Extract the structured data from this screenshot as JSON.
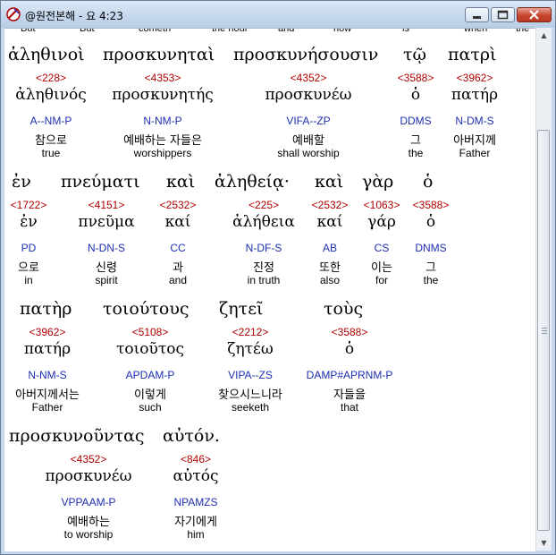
{
  "window": {
    "title": "@원전본해 - 요 4:23"
  },
  "top_strip": [
    "But",
    "But",
    "cometh",
    "the hour",
    "and",
    "now",
    "is",
    "when",
    "the"
  ],
  "rows": [
    [
      {
        "greek": "ἀληθινοὶ",
        "num": "<228>",
        "lex": "ἀληθινός",
        "morph": "A--NM-P",
        "kor": "참으로",
        "eng": "true"
      },
      {
        "greek": "προσκυνηταὶ",
        "num": "<4353>",
        "lex": "προσκυνητής",
        "morph": "N-NM-P",
        "kor": "예배하는 자들은",
        "eng": "worshippers"
      },
      {
        "greek": "προσκυνήσουσιν",
        "num": "<4352>",
        "lex": "προσκυνέω",
        "morph": "VIFA--ZP",
        "kor": "예배할",
        "eng": "shall worship"
      },
      {
        "greek": "τῷ",
        "num": "<3588>",
        "lex": "ὁ",
        "morph": "DDMS",
        "kor": "그",
        "eng": "the"
      },
      {
        "greek": "πατρὶ",
        "num": "<3962>",
        "lex": "πατήρ",
        "morph": "N-DM-S",
        "kor": "아버지께",
        "eng": "Father"
      }
    ],
    [
      {
        "greek": "ἐν",
        "num": "<1722>",
        "lex": "ἐν",
        "morph": "PD",
        "kor": "으로",
        "eng": "in"
      },
      {
        "greek": "πνεύματι",
        "num": "<4151>",
        "lex": "πνεῦμα",
        "morph": "N-DN-S",
        "kor": "신령",
        "eng": "spirit"
      },
      {
        "greek": "καὶ",
        "num": "<2532>",
        "lex": "καί",
        "morph": "CC",
        "kor": "과",
        "eng": "and"
      },
      {
        "greek": "ἀληθείᾳ·",
        "num": "<225>",
        "lex": "ἀλήθεια",
        "morph": "N-DF-S",
        "kor": "진정",
        "eng": "in truth"
      },
      {
        "greek": "καὶ",
        "num": "<2532>",
        "lex": "καί",
        "morph": "AB",
        "kor": "또한",
        "eng": "also"
      },
      {
        "greek": "γὰρ",
        "num": "<1063>",
        "lex": "γάρ",
        "morph": "CS",
        "kor": "이는",
        "eng": "for"
      },
      {
        "greek": "ὁ",
        "num": "<3588>",
        "lex": "ὁ",
        "morph": "DNMS",
        "kor": "그",
        "eng": "the"
      }
    ],
    [
      {
        "greek": "πατὴρ",
        "num": "<3962>",
        "lex": "πατήρ",
        "morph": "N-NM-S",
        "kor": "아버지께서는",
        "eng": "Father"
      },
      {
        "greek": "τοιούτους",
        "num": "<5108>",
        "lex": "τοιοῦτος",
        "morph": "APDAM-P",
        "kor": "이렇게",
        "eng": "such"
      },
      {
        "greek": "ζητεῖ",
        "num": "<2212>",
        "lex": "ζητέω",
        "morph": "VIPA--ZS",
        "kor": "찾으시느니라",
        "eng": "seeketh"
      },
      {
        "greek": "τοὺς",
        "num": "<3588>",
        "lex": "ὁ",
        "morph": "DAMP#APRNM-P",
        "kor": "자들을",
        "eng": "that"
      }
    ],
    [
      {
        "greek": "προσκυνοῦντας",
        "num": "<4352>",
        "lex": "προσκυνέω",
        "morph": "VPPAAM-P",
        "kor": "예배하는",
        "eng": "to worship"
      },
      {
        "greek": "αὐτόν.",
        "num": "<846>",
        "lex": "αὐτός",
        "morph": "NPAMZS",
        "kor": "자기에게",
        "eng": "him"
      }
    ]
  ]
}
